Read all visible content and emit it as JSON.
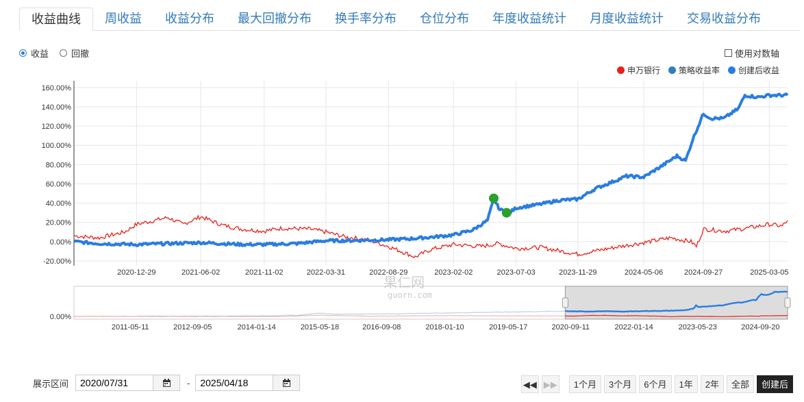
{
  "tabs": [
    "收益曲线",
    "周收益",
    "收益分布",
    "最大回撤分布",
    "换手率分布",
    "仓位分布",
    "年度收益统计",
    "月度收益统计",
    "交易收益分布"
  ],
  "active_tab": 0,
  "radios": {
    "option1": "收益",
    "option2": "回撤"
  },
  "log_axis_label": "使用对数轴",
  "legend": [
    {
      "name": "申万银行",
      "color": "#e8201a"
    },
    {
      "name": "策略收益率",
      "color": "#2f7ec2"
    },
    {
      "name": "创建后收益",
      "color": "#2a7de1"
    }
  ],
  "colors": {
    "red": "#e8201a",
    "blue": "#2a7de1",
    "green": "#2ca02c",
    "nav_fill": "#d9d9d9"
  },
  "chart_data": {
    "type": "line",
    "y_ticks": [
      "160.00%",
      "140.00%",
      "120.00%",
      "100.00%",
      "80.00%",
      "60.00%",
      "40.00%",
      "20.00%",
      "0.00%",
      "-20.00%"
    ],
    "x_ticks": [
      "2020-12-29",
      "2021-06-02",
      "2021-11-02",
      "2022-03-31",
      "2022-08-29",
      "2023-02-02",
      "2023-07-03",
      "2023-11-29",
      "2024-05-06",
      "2024-09-27",
      "2025-03-05"
    ],
    "ylim": [
      -25,
      167
    ],
    "xlim": [
      "2020-07-31",
      "2025-04-18"
    ],
    "series": [
      {
        "name": "申万银行",
        "key": "red",
        "points": [
          [
            "2020-07-31",
            6
          ],
          [
            "2020-09-30",
            4
          ],
          [
            "2020-11-30",
            10
          ],
          [
            "2020-12-29",
            18
          ],
          [
            "2021-02-10",
            22
          ],
          [
            "2021-03-15",
            25
          ],
          [
            "2021-04-20",
            18
          ],
          [
            "2021-06-02",
            26
          ],
          [
            "2021-07-25",
            17
          ],
          [
            "2021-09-10",
            13
          ],
          [
            "2021-11-02",
            11
          ],
          [
            "2021-12-15",
            14
          ],
          [
            "2022-02-20",
            13
          ],
          [
            "2022-03-31",
            10
          ],
          [
            "2022-05-15",
            5
          ],
          [
            "2022-07-10",
            2
          ],
          [
            "2022-08-29",
            -5
          ],
          [
            "2022-10-10",
            -12
          ],
          [
            "2022-11-01",
            -16
          ],
          [
            "2022-12-10",
            -8
          ],
          [
            "2023-02-02",
            -3
          ],
          [
            "2023-04-10",
            -5
          ],
          [
            "2023-05-20",
            -2
          ],
          [
            "2023-07-03",
            -7
          ],
          [
            "2023-09-01",
            -6
          ],
          [
            "2023-11-29",
            -13
          ],
          [
            "2024-01-05",
            -10
          ],
          [
            "2024-03-10",
            -5
          ],
          [
            "2024-05-06",
            -1
          ],
          [
            "2024-07-10",
            4
          ],
          [
            "2024-08-28",
            0
          ],
          [
            "2024-09-10",
            -5
          ],
          [
            "2024-09-27",
            13
          ],
          [
            "2024-11-20",
            11
          ],
          [
            "2025-01-10",
            14
          ],
          [
            "2025-03-05",
            18
          ],
          [
            "2025-04-05",
            16
          ],
          [
            "2025-04-18",
            22
          ]
        ]
      },
      {
        "name": "创建后收益",
        "key": "blue",
        "points": [
          [
            "2020-07-31",
            0
          ],
          [
            "2020-09-30",
            -2
          ],
          [
            "2020-12-29",
            -3
          ],
          [
            "2021-03-15",
            -2
          ],
          [
            "2021-06-02",
            -1
          ],
          [
            "2021-09-10",
            -3
          ],
          [
            "2021-11-02",
            -3
          ],
          [
            "2022-01-20",
            -2
          ],
          [
            "2022-03-31",
            1
          ],
          [
            "2022-05-20",
            1
          ],
          [
            "2022-08-29",
            2
          ],
          [
            "2022-10-20",
            3
          ],
          [
            "2022-12-20",
            5
          ],
          [
            "2023-02-02",
            7
          ],
          [
            "2023-03-20",
            12
          ],
          [
            "2023-04-25",
            22
          ],
          [
            "2023-05-10",
            44
          ],
          [
            "2023-05-25",
            33
          ],
          [
            "2023-06-20",
            31
          ],
          [
            "2023-07-03",
            35
          ],
          [
            "2023-09-01",
            39
          ],
          [
            "2023-10-15",
            43
          ],
          [
            "2023-11-29",
            44
          ],
          [
            "2024-01-10",
            55
          ],
          [
            "2024-02-20",
            62
          ],
          [
            "2024-03-25",
            68
          ],
          [
            "2024-05-06",
            67
          ],
          [
            "2024-06-20",
            79
          ],
          [
            "2024-07-25",
            89
          ],
          [
            "2024-08-15",
            84
          ],
          [
            "2024-09-01",
            106
          ],
          [
            "2024-09-27",
            133
          ],
          [
            "2024-10-15",
            128
          ],
          [
            "2024-11-15",
            128
          ],
          [
            "2024-12-20",
            138
          ],
          [
            "2025-01-05",
            152
          ],
          [
            "2025-02-05",
            150
          ],
          [
            "2025-03-05",
            152
          ],
          [
            "2025-04-18",
            152
          ]
        ]
      }
    ],
    "markers": [
      {
        "date": "2023-05-10",
        "value": 45
      },
      {
        "date": "2023-06-10",
        "value": 30
      }
    ],
    "navigator": {
      "x_ticks": [
        "2011-05-11",
        "2012-09-05",
        "2014-01-14",
        "2015-05-18",
        "2016-09-08",
        "2018-01-10",
        "2019-05-17",
        "2020-09-11",
        "2022-01-14",
        "2023-05-23",
        "2024-09-20"
      ],
      "y_tick": "0.00%"
    }
  },
  "watermark": {
    "cn": "果仁网",
    "en": "guorn.com"
  },
  "range": {
    "label": "展示区间",
    "start": "2020/07/31",
    "end": "2025/04/18",
    "separator": "-"
  },
  "buttons": [
    "1个月",
    "3个月",
    "6个月",
    "1年",
    "2年",
    "全部",
    "创建后"
  ]
}
